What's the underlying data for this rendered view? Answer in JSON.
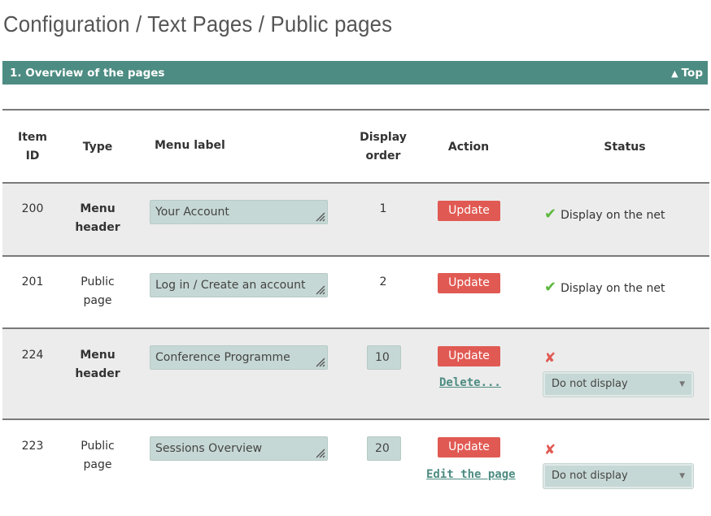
{
  "breadcrumb": {
    "text": "Configuration / Text Pages / Public pages"
  },
  "section": {
    "title": "1. Overview of the pages",
    "top_label": "Top",
    "top_arrow": "▲"
  },
  "table": {
    "headers": {
      "item_id_1": "Item",
      "item_id_2": "ID",
      "type": "Type",
      "menu_label": "Menu label",
      "display_1": "Display",
      "display_2": "order",
      "action": "Action",
      "status": "Status"
    },
    "rows": [
      {
        "id": "200",
        "type_1": "Menu",
        "type_2": "header",
        "menu_label": "Your Account",
        "display_order": "1",
        "update_label": "Update",
        "status_text": "Display on the net"
      },
      {
        "id": "201",
        "type_1": "Public",
        "type_2": "page",
        "menu_label": "Log in / Create an account",
        "display_order": "2",
        "update_label": "Update",
        "status_text": "Display on the net"
      },
      {
        "id": "224",
        "type_1": "Menu",
        "type_2": "header",
        "menu_label": "Conference Programme",
        "display_order": "10",
        "update_label": "Update",
        "link_label": "Delete...",
        "status_select": "Do not display"
      },
      {
        "id": "223",
        "type_1": "Public",
        "type_2": "page",
        "menu_label": "Sessions Overview",
        "display_order": "20",
        "update_label": "Update",
        "link_label": "Edit the page",
        "status_select": "Do not display"
      }
    ]
  },
  "icons": {
    "check": "✔",
    "cross": "✘",
    "caret": "▼"
  },
  "colors": {
    "accent": "#4d8c82",
    "button": "#e05a53",
    "check": "#5cb83b",
    "input_bg": "#c6d8d5",
    "row_shade": "#ececec"
  }
}
